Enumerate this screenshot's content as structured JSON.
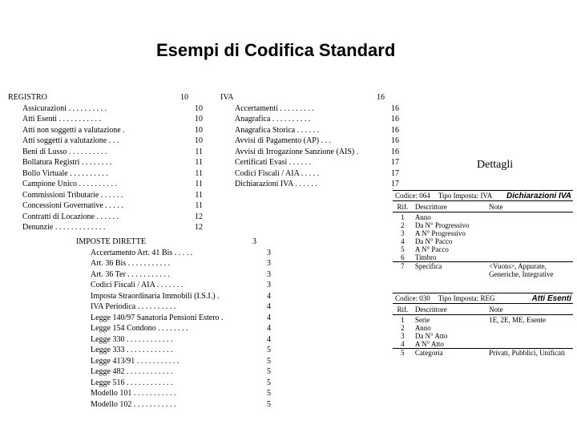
{
  "title": "Esempi di Codifica Standard",
  "dettagli_label": "Dettagli",
  "registro": {
    "header": {
      "label": "REGISTRO",
      "page": "10"
    },
    "items": [
      {
        "label": "Assicurazioni",
        "page": "10"
      },
      {
        "label": "Atti Esenti",
        "page": "10"
      },
      {
        "label": "Atti non soggetti a valutazione",
        "page": "10"
      },
      {
        "label": "Atti soggetti a valutazione",
        "page": "10"
      },
      {
        "label": "Beni di Lusso",
        "page": "11"
      },
      {
        "label": "Bollatura Registri",
        "page": "11"
      },
      {
        "label": "Bollo Virtuale",
        "page": "11"
      },
      {
        "label": "Campione Unico",
        "page": "11"
      },
      {
        "label": "Commissioni Tributarie",
        "page": "11"
      },
      {
        "label": "Concessioni Governative",
        "page": "11"
      },
      {
        "label": "Contratti di Locazione",
        "page": "12"
      },
      {
        "label": "Denunzie",
        "page": "12"
      }
    ]
  },
  "imposte": {
    "header": {
      "label": "IMPOSTE DIRETTE",
      "page": "3"
    },
    "items": [
      {
        "label": "Accertamento Art. 41 Bis",
        "page": "3"
      },
      {
        "label": "Art. 36 Bis",
        "page": "3"
      },
      {
        "label": "Art. 36 Ter",
        "page": "3"
      },
      {
        "label": "Codici Fiscali / AIA",
        "page": "3"
      },
      {
        "label": "Imposta Straordinaria Immobili (I.S.I.)",
        "page": "4"
      },
      {
        "label": "IVA Periodica",
        "page": "4"
      },
      {
        "label": "Legge 140/97 Sanatoria Pensioni Estero",
        "page": "4"
      },
      {
        "label": "Legge 154 Condono",
        "page": "4"
      },
      {
        "label": "Legge 330",
        "page": "4"
      },
      {
        "label": "Legge 333",
        "page": "5"
      },
      {
        "label": "Legge 413/91",
        "page": "5"
      },
      {
        "label": "Legge 482",
        "page": "5"
      },
      {
        "label": "Legge 516",
        "page": "5"
      },
      {
        "label": "Modello 101",
        "page": "5"
      },
      {
        "label": "Modello 102",
        "page": "5"
      }
    ]
  },
  "iva": {
    "header": {
      "label": "IVA",
      "page": "16"
    },
    "items": [
      {
        "label": "Accertamenti",
        "page": "16"
      },
      {
        "label": "Anagrafica",
        "page": "16"
      },
      {
        "label": "Anagrafica Storica",
        "page": "16"
      },
      {
        "label": "Avvisi di Pagamento (AP)",
        "page": "16"
      },
      {
        "label": "Avvisi di Irrogazione Sanzione (AIS)",
        "page": "16"
      },
      {
        "label": "Certificati Evasi",
        "page": "17"
      },
      {
        "label": "Codici Fiscali / AIA",
        "page": "17"
      },
      {
        "label": "Dichiarazioni IVA",
        "page": "17"
      }
    ]
  },
  "box1": {
    "codice_label": "Codice:",
    "codice": "064",
    "tipo_label": "Tipo Imposta:",
    "tipo": "IVA",
    "name": "Dichiarazioni IVA",
    "cols": {
      "rif": "Rif.",
      "desc": "Descrittore",
      "note": "Note"
    },
    "rows": [
      {
        "rif": "1",
        "desc": "Anno",
        "note": ""
      },
      {
        "rif": "2",
        "desc": "Da N° Progressivo",
        "note": ""
      },
      {
        "rif": "3",
        "desc": "A N° Progressivo",
        "note": ""
      },
      {
        "rif": "4",
        "desc": "Da N° Pacco",
        "note": ""
      },
      {
        "rif": "5",
        "desc": "A N° Pacco",
        "note": ""
      },
      {
        "rif": "6",
        "desc": "Timbro",
        "note": ""
      },
      {
        "rif": "7",
        "desc": "Specifica",
        "note": "<Vuoto>, Appurate, Generiche, Integrative"
      }
    ]
  },
  "box2": {
    "codice_label": "Codice:",
    "codice": "030",
    "tipo_label": "Tipo Imposta:",
    "tipo": "REG",
    "name": "Atti Esenti",
    "cols": {
      "rif": "Rif.",
      "desc": "Descrittore",
      "note": "Note"
    },
    "rows": [
      {
        "rif": "1",
        "desc": "Serie",
        "note": "1E, 2E, ME, Esente"
      },
      {
        "rif": "2",
        "desc": "Anno",
        "note": ""
      },
      {
        "rif": "3",
        "desc": "Da N° Atto",
        "note": ""
      },
      {
        "rif": "4",
        "desc": "A N° Atto",
        "note": ""
      },
      {
        "rif": "5",
        "desc": "Categoria",
        "note": "Privati, Pubblici, Unificati"
      }
    ]
  }
}
